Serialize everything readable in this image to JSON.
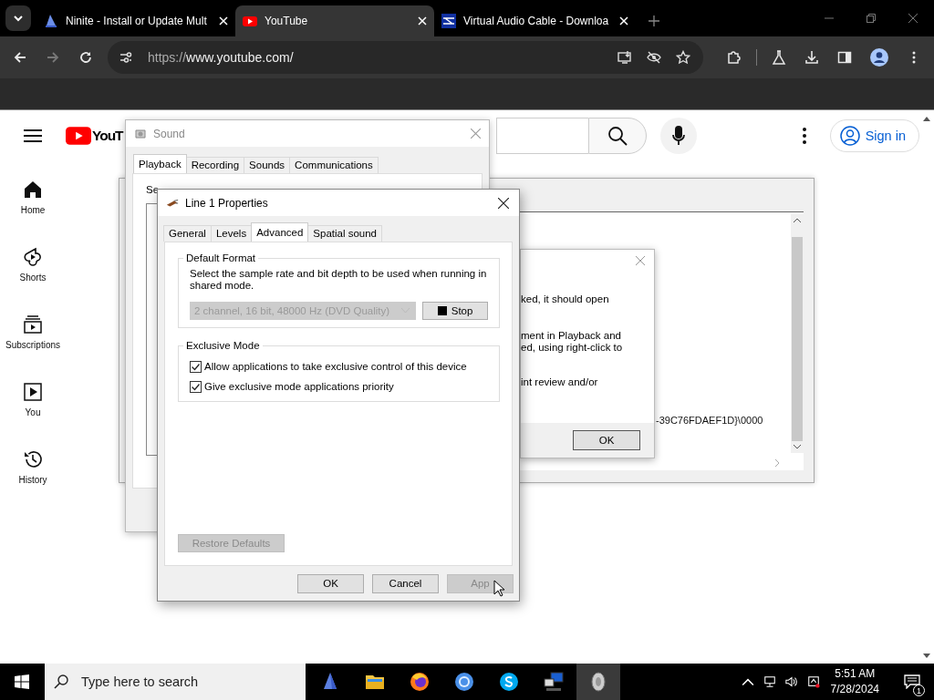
{
  "browser": {
    "tabs": [
      {
        "title": "Ninite - Install or Update Mult",
        "selected": false
      },
      {
        "title": "YouTube",
        "selected": true
      },
      {
        "title": "Virtual Audio Cable - Downloa",
        "selected": false
      }
    ],
    "url_scheme": "https://",
    "url_rest": "www.youtube.com/"
  },
  "youtube": {
    "logo_text": "YouT",
    "sign_in": "Sign in",
    "sidebar": [
      {
        "label": "Home",
        "kind": "home"
      },
      {
        "label": "Shorts",
        "kind": "shorts"
      },
      {
        "label": "Subscriptions",
        "kind": "subscriptions"
      },
      {
        "label": "You",
        "kind": "you"
      },
      {
        "label": "History",
        "kind": "history"
      }
    ]
  },
  "background_window": {
    "text": "-39C76FDAEF1D}\\0000"
  },
  "message_dialog": {
    "lines": [
      "ked, it should open",
      "ment in Playback and",
      "ed, using right-click to",
      "int review and/or"
    ],
    "ok": "OK"
  },
  "sound_window": {
    "title": "Sound",
    "tabs": [
      {
        "label": "Playback",
        "selected": true
      },
      {
        "label": "Recording",
        "selected": false
      },
      {
        "label": "Sounds",
        "selected": false
      },
      {
        "label": "Communications",
        "selected": false
      }
    ],
    "text": "Se"
  },
  "properties": {
    "title": "Line 1 Properties",
    "tabs": [
      {
        "label": "General",
        "selected": false
      },
      {
        "label": "Levels",
        "selected": false
      },
      {
        "label": "Advanced",
        "selected": true
      },
      {
        "label": "Spatial sound",
        "selected": false
      }
    ],
    "default_format": {
      "legend": "Default Format",
      "description": "Select the sample rate and bit depth to be used when running in shared mode.",
      "format": "2 channel, 16 bit, 48000 Hz (DVD Quality)",
      "format_disabled": true,
      "stop": "Stop"
    },
    "exclusive_mode": {
      "legend": "Exclusive Mode",
      "options": [
        {
          "label": "Allow applications to take exclusive control of this device",
          "checked": true
        },
        {
          "label": "Give exclusive mode applications priority",
          "checked": true
        }
      ]
    },
    "restore_defaults": {
      "label": "Restore Defaults",
      "disabled": true
    },
    "buttons": [
      {
        "label": "OK",
        "disabled": false
      },
      {
        "label": "Cancel",
        "disabled": false
      },
      {
        "label": "App",
        "disabled": true
      }
    ]
  },
  "taskbar": {
    "search_placeholder": "Type here to search",
    "apps": [
      {
        "kind": "sail",
        "active": false
      },
      {
        "kind": "folder",
        "active": false
      },
      {
        "kind": "firefox",
        "active": false
      },
      {
        "kind": "browser",
        "active": false
      },
      {
        "kind": "skype",
        "active": false
      },
      {
        "kind": "network",
        "active": false
      },
      {
        "kind": "sound",
        "active": true
      }
    ],
    "time": "5:51 AM",
    "date": "7/28/2024",
    "notifications": "1"
  }
}
